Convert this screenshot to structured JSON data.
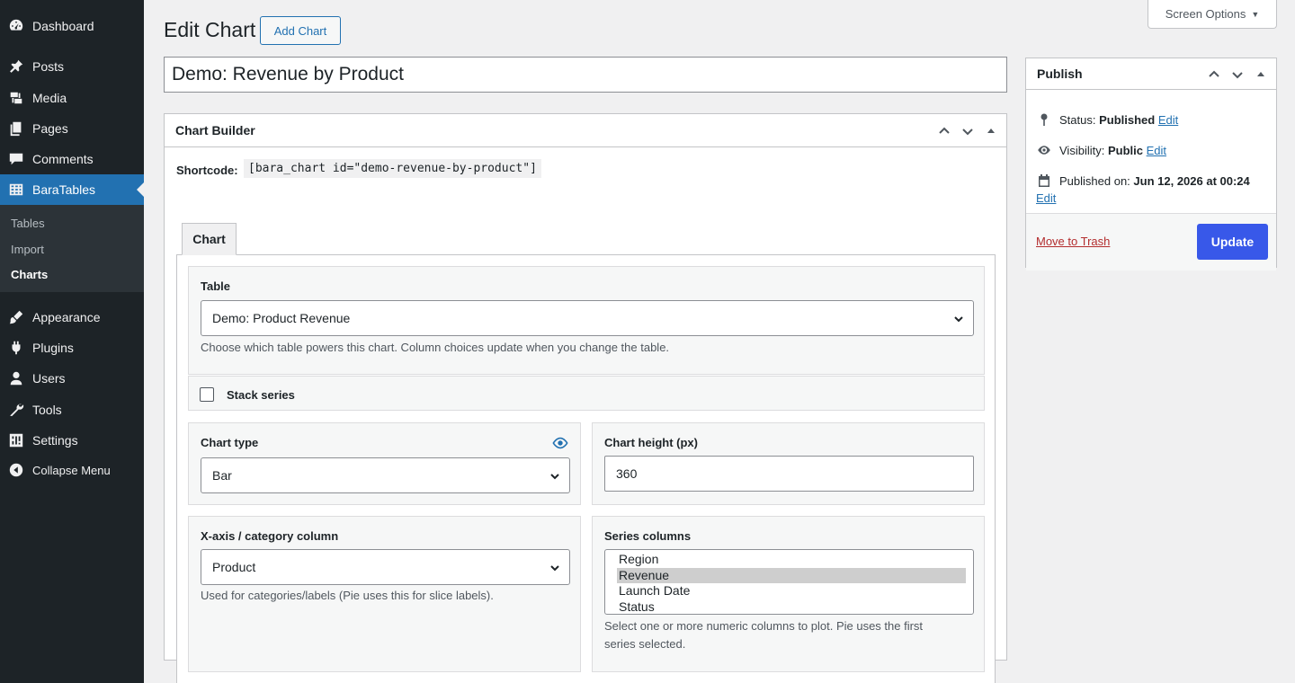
{
  "sidebar": {
    "items": [
      {
        "label": "Dashboard",
        "icon": "dashboard-icon"
      },
      {
        "label": "Posts",
        "icon": "pin-icon"
      },
      {
        "label": "Media",
        "icon": "media-icon"
      },
      {
        "label": "Pages",
        "icon": "pages-icon"
      },
      {
        "label": "Comments",
        "icon": "comment-icon"
      },
      {
        "label": "BaraTables",
        "icon": "table-icon"
      },
      {
        "label": "Appearance",
        "icon": "brush-icon"
      },
      {
        "label": "Plugins",
        "icon": "plug-icon"
      },
      {
        "label": "Users",
        "icon": "user-icon"
      },
      {
        "label": "Tools",
        "icon": "wrench-icon"
      },
      {
        "label": "Settings",
        "icon": "settings-icon"
      },
      {
        "label": "Collapse Menu",
        "icon": "collapse-icon"
      }
    ],
    "submenu": [
      "Tables",
      "Import",
      "Charts"
    ]
  },
  "header": {
    "title": "Edit Chart",
    "add_button": "Add Chart",
    "screen_options": "Screen Options"
  },
  "post_title": "Demo: Revenue by Product",
  "builder": {
    "title": "Chart Builder",
    "shortcode_label": "Shortcode:",
    "shortcode": "[bara_chart id=\"demo-revenue-by-product\"]",
    "tab": "Chart",
    "table": {
      "label": "Table",
      "value": "Demo: Product Revenue",
      "help": "Choose which table powers this chart. Column choices update when you change the table."
    },
    "stack": {
      "label": "Stack series",
      "checked": false
    },
    "chart_type": {
      "label": "Chart type",
      "value": "Bar"
    },
    "chart_height": {
      "label": "Chart height (px)",
      "value": "360"
    },
    "x_axis": {
      "label": "X-axis / category column",
      "value": "Product",
      "help": "Used for categories/labels (Pie uses this for slice labels)."
    },
    "series": {
      "label": "Series columns",
      "options": [
        "Region",
        "Revenue",
        "Launch Date",
        "Status"
      ],
      "selected": "Revenue",
      "help_line1": "Select one or more numeric columns to plot. Pie uses the first",
      "help_line2": "series selected."
    }
  },
  "publish": {
    "title": "Publish",
    "status_label": "Status:",
    "status_value": "Published",
    "visibility_label": "Visibility:",
    "visibility_value": "Public",
    "published_label": "Published on:",
    "published_value": "Jun 12, 2026 at 00:24",
    "edit": "Edit",
    "trash": "Move to Trash",
    "update": "Update"
  },
  "colors": {
    "accent": "#2271b1",
    "update_button": "#3858e9",
    "sidebar_bg": "#1d2327",
    "trash": "#b32d2e"
  }
}
